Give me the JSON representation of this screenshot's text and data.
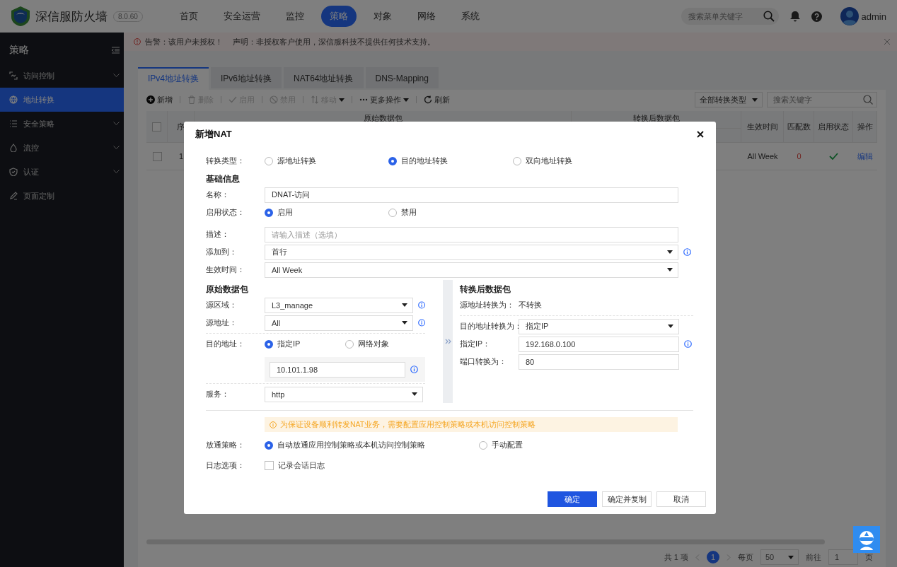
{
  "app": {
    "name": "深信服防火墙",
    "version": "8.0.60"
  },
  "nav": [
    {
      "label": "首页",
      "selected": false
    },
    {
      "label": "安全运营",
      "selected": false
    },
    {
      "label": "监控",
      "selected": false
    },
    {
      "label": "策略",
      "selected": true
    },
    {
      "label": "对象",
      "selected": false
    },
    {
      "label": "网络",
      "selected": false
    },
    {
      "label": "系统",
      "selected": false
    }
  ],
  "header": {
    "search_placeholder": "搜索菜单关键字",
    "user": "admin"
  },
  "sidebar": {
    "title": "策略",
    "items": [
      {
        "label": "访问控制",
        "selected": false,
        "expandable": true
      },
      {
        "label": "地址转换",
        "selected": true,
        "expandable": false
      },
      {
        "label": "安全策略",
        "selected": false,
        "expandable": true
      },
      {
        "label": "流控",
        "selected": false,
        "expandable": true
      },
      {
        "label": "认证",
        "selected": false,
        "expandable": true
      },
      {
        "label": "页面定制",
        "selected": false,
        "expandable": false
      }
    ]
  },
  "alert": {
    "warning": "告警：该用户未授权！",
    "notice": "声明：非授权客户使用，深信服科技不提供任何技术支持。"
  },
  "tabs": [
    {
      "label": "IPv4地址转换",
      "selected": true
    },
    {
      "label": "IPv6地址转换",
      "selected": false
    },
    {
      "label": "NAT64地址转换",
      "selected": false
    },
    {
      "label": "DNS-Mapping",
      "selected": false
    }
  ],
  "toolbar": {
    "buttons": [
      {
        "label": "新增",
        "disabled": false,
        "dropdown": false
      },
      {
        "label": "删除",
        "disabled": true,
        "dropdown": false
      },
      {
        "label": "启用",
        "disabled": true,
        "dropdown": false
      },
      {
        "label": "禁用",
        "disabled": true,
        "dropdown": false
      },
      {
        "label": "移动",
        "disabled": true,
        "dropdown": true
      },
      {
        "label": "更多操作",
        "disabled": false,
        "dropdown": true
      },
      {
        "label": "刷新",
        "disabled": false,
        "dropdown": false
      }
    ],
    "filter": "全部转换类型",
    "search_placeholder": "搜索关键字"
  },
  "table": {
    "columns": {
      "index": "序",
      "original": "原始数据包",
      "translated": "转换后数据包",
      "schedule": "生效时间",
      "matches": "匹配数",
      "status": "启用状态",
      "action": "操作"
    },
    "all_checked": false,
    "rows": [
      {
        "checked": false,
        "index": "1",
        "schedule": "All Week",
        "matches": "0",
        "enabled": true,
        "action": "编辑"
      }
    ]
  },
  "pagination": {
    "total": "共 1 项",
    "current": "1",
    "per_page_label": "每页",
    "per_page": "50",
    "goto_label": "前往",
    "goto": "1",
    "page_unit": "页"
  },
  "dialog": {
    "title": "新增NAT",
    "type": {
      "label": "转换类型：",
      "options": [
        {
          "label": "源地址转换",
          "selected": false
        },
        {
          "label": "目的地址转换",
          "selected": true
        },
        {
          "label": "双向地址转换",
          "selected": false
        }
      ]
    },
    "basic": {
      "heading": "基础信息",
      "name_label": "名称：",
      "name": "DNAT-访问",
      "status_label": "启用状态：",
      "status_options": [
        {
          "label": "启用",
          "selected": true
        },
        {
          "label": "禁用",
          "selected": false
        }
      ],
      "desc_label": "描述：",
      "desc_placeholder": "请输入描述（选填）",
      "add_to_label": "添加到：",
      "add_to": "首行",
      "schedule_label": "生效时间：",
      "schedule": "All Week"
    },
    "original": {
      "heading": "原始数据包",
      "zone_label": "源区域：",
      "zone": "L3_manage",
      "src_label": "源地址：",
      "src": "All",
      "dst_label": "目的地址：",
      "dst_options": [
        {
          "label": "指定IP",
          "selected": true
        },
        {
          "label": "网络对象",
          "selected": false
        }
      ],
      "dst_ip": "10.101.1.98",
      "service_label": "服务：",
      "service": "http"
    },
    "translated": {
      "heading": "转换后数据包",
      "src_label": "源地址转换为：",
      "src": "不转换",
      "dst_label": "目的地址转换为：",
      "dst": "指定IP",
      "ip_label": "指定IP：",
      "ip": "192.168.0.100",
      "port_label": "端口转换为：",
      "port": "80"
    },
    "notice": "为保证设备顺利转发NAT业务，需要配置应用控制策略或本机访问控制策略",
    "policy": {
      "label": "放通策略：",
      "options": [
        {
          "label": "自动放通应用控制策略或本机访问控制策略",
          "selected": true
        },
        {
          "label": "手动配置",
          "selected": false
        }
      ]
    },
    "log": {
      "label": "日志选项：",
      "option": "记录会话日志",
      "checked": false
    },
    "buttons": [
      {
        "label": "确定",
        "primary": true
      },
      {
        "label": "确定并复制",
        "primary": false
      },
      {
        "label": "取消",
        "primary": false
      }
    ]
  }
}
